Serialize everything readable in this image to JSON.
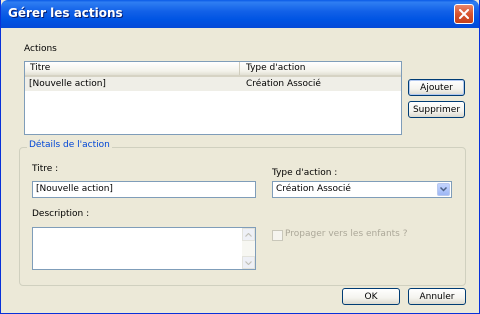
{
  "window": {
    "title": "Gérer les actions"
  },
  "actions": {
    "section_label": "Actions",
    "columns": [
      "Titre",
      "Type d'action"
    ],
    "rows": [
      {
        "title": "[Nouvelle action]",
        "type": "Création Associé"
      }
    ],
    "add_button": "Ajouter",
    "delete_button": "Supprimer"
  },
  "details": {
    "group_label": "Détails de l'action",
    "title_label": "Titre :",
    "title_value": "[Nouvelle action]",
    "type_label": "Type d'action :",
    "type_value": "Création Associé",
    "description_label": "Description :",
    "description_value": "",
    "propagate_label": "Propager vers les enfants ?",
    "propagate_checked": false,
    "propagate_enabled": false
  },
  "footer": {
    "ok_button": "OK",
    "cancel_button": "Annuler"
  },
  "icons": [
    "close-icon",
    "chevron-down-icon",
    "scroll-up-icon",
    "scroll-down-icon"
  ],
  "colors": {
    "titlebar": "#0054e3",
    "dialog_bg": "#ece9d8",
    "group_label": "#0046d5",
    "close_button": "#d8542e"
  }
}
